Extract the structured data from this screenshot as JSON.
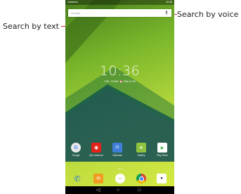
{
  "callouts": {
    "text": "Search by text",
    "voice": "Search by voice"
  },
  "status": {
    "carrier": "Vodafone",
    "time": "10:36"
  },
  "search": {
    "placeholder": "Google",
    "icon": "mic-icon"
  },
  "clock": {
    "time": "10:36",
    "date": "TUE, 13 MAY  ⏰ SUN 17:30"
  },
  "apps": [
    {
      "label": "Google",
      "icon": "google-icon",
      "color": "#e9e9e9"
    },
    {
      "label": "My Vodacom",
      "icon": "vodacom-icon",
      "color": "#e2231a"
    },
    {
      "label": "Calendar",
      "icon": "calendar-icon",
      "color": "#3f7fd9"
    },
    {
      "label": "Gallery",
      "icon": "gallery-icon",
      "color": "#8fc23f"
    },
    {
      "label": "Play Store",
      "icon": "play-store-icon",
      "color": "#ffffff"
    }
  ],
  "dock": [
    {
      "icon": "phone-icon",
      "color": "#2f7fd8"
    },
    {
      "icon": "messaging-icon",
      "color": "#f29b1f"
    },
    {
      "icon": "apps-icon",
      "color": "#ffffff"
    },
    {
      "icon": "chrome-icon",
      "color": "#db4437"
    },
    {
      "icon": "camera-icon",
      "color": "#ffffff"
    }
  ],
  "nav": {
    "back": "◁",
    "home": "○",
    "recents": "□"
  },
  "colors": {
    "callout_line": "#d1282e",
    "wallpaper": "#b4d83c"
  }
}
